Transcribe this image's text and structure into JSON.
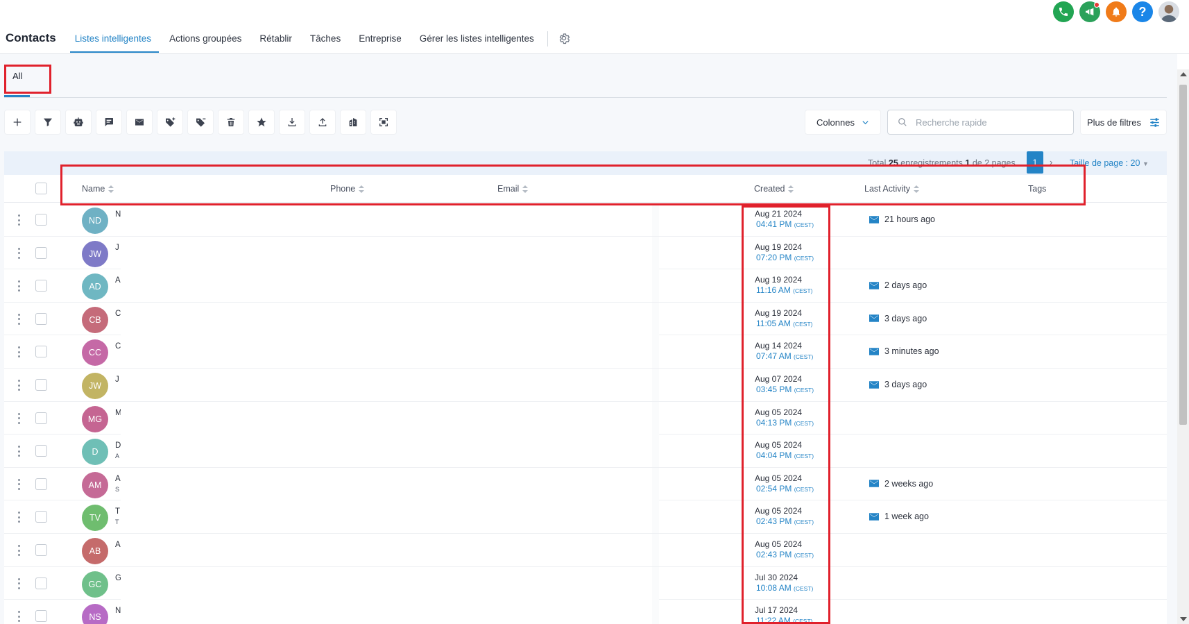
{
  "header": {
    "title": "Contacts",
    "tabs": [
      "Listes intelligentes",
      "Actions groupées",
      "Rétablir",
      "Tâches",
      "Entreprise",
      "Gérer les listes intelligentes"
    ],
    "help_label": "?"
  },
  "smart_list": {
    "active_tab": "All"
  },
  "toolbar": {
    "columns_label": "Colonnes",
    "search_placeholder": "Recherche rapide",
    "more_filters_label": "Plus de filtres"
  },
  "pagination": {
    "prefix": "Total",
    "total": "25",
    "middle": "enregistrements",
    "current": "1",
    "of_label": "de",
    "pages_count": "2",
    "pages_label": "pages",
    "active_page": "1",
    "page_size_label": "Taille de page : 20"
  },
  "table": {
    "columns": [
      "Name",
      "Phone",
      "Email",
      "Created",
      "Last Activity",
      "Tags"
    ],
    "rows": [
      {
        "initials": "ND",
        "name": "N",
        "sub": "",
        "color": "#6fb1c4",
        "date": "Aug 21 2024",
        "time": "04:41 PM",
        "tz": "(CEST)",
        "activity": "21 hours ago"
      },
      {
        "initials": "JW",
        "name": "J",
        "sub": "",
        "color": "#7e7ac7",
        "date": "Aug 19 2024",
        "time": "07:20 PM",
        "tz": "(CEST)",
        "activity": ""
      },
      {
        "initials": "AD",
        "name": "A",
        "sub": "",
        "color": "#6fb7c2",
        "date": "Aug 19 2024",
        "time": "11:16 AM",
        "tz": "(CEST)",
        "activity": "2 days ago"
      },
      {
        "initials": "CB",
        "name": "C",
        "sub": "",
        "color": "#c56b7a",
        "date": "Aug 19 2024",
        "time": "11:05 AM",
        "tz": "(CEST)",
        "activity": "3 days ago"
      },
      {
        "initials": "CC",
        "name": "C",
        "sub": "",
        "color": "#c569a6",
        "date": "Aug 14 2024",
        "time": "07:47 AM",
        "tz": "(CEST)",
        "activity": "3 minutes ago"
      },
      {
        "initials": "JW",
        "name": "J",
        "sub": "",
        "color": "#c2b463",
        "date": "Aug 07 2024",
        "time": "03:45 PM",
        "tz": "(CEST)",
        "activity": "3 days ago"
      },
      {
        "initials": "MG",
        "name": "M",
        "sub": "",
        "color": "#c56592",
        "date": "Aug 05 2024",
        "time": "04:13 PM",
        "tz": "(CEST)",
        "activity": ""
      },
      {
        "initials": "D",
        "name": "D",
        "sub": "A",
        "color": "#6fbfb6",
        "date": "Aug 05 2024",
        "time": "04:04 PM",
        "tz": "(CEST)",
        "activity": ""
      },
      {
        "initials": "AM",
        "name": "A",
        "sub": "S",
        "color": "#c56a96",
        "date": "Aug 05 2024",
        "time": "02:54 PM",
        "tz": "(CEST)",
        "activity": "2 weeks ago"
      },
      {
        "initials": "TV",
        "name": "T",
        "sub": "T",
        "color": "#6fbd6f",
        "date": "Aug 05 2024",
        "time": "02:43 PM",
        "tz": "(CEST)",
        "activity": "1 week ago"
      },
      {
        "initials": "AB",
        "name": "A",
        "sub": "",
        "color": "#c56b6b",
        "date": "Aug 05 2024",
        "time": "02:43 PM",
        "tz": "(CEST)",
        "activity": ""
      },
      {
        "initials": "GC",
        "name": "G",
        "sub": "",
        "color": "#6fc08a",
        "date": "Jul 30 2024",
        "time": "10:08 AM",
        "tz": "(CEST)",
        "activity": ""
      },
      {
        "initials": "NS",
        "name": "N",
        "sub": "",
        "color": "#b76bc5",
        "date": "Jul 17 2024",
        "time": "11:22 AM",
        "tz": "(CEST)",
        "activity": ""
      }
    ]
  },
  "colors": {
    "accent": "#2484c6",
    "highlight": "#e0212c"
  }
}
